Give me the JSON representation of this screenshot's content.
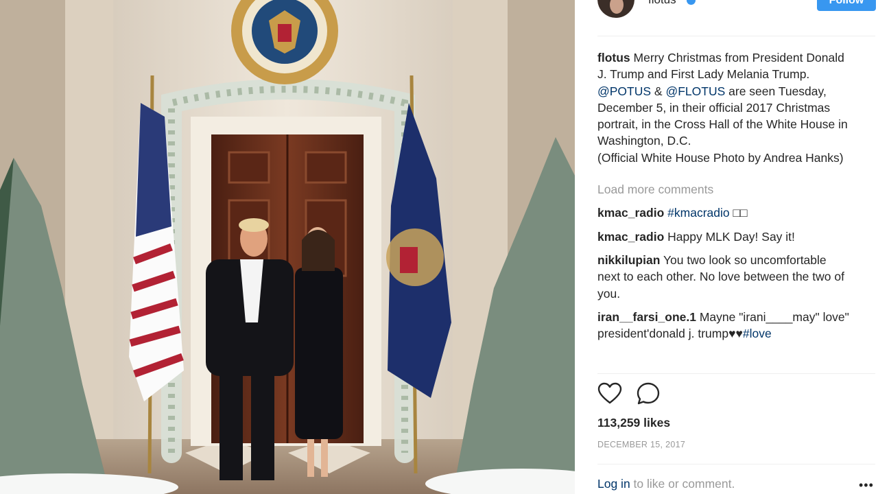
{
  "post": {
    "username": "flotus",
    "follow_label": "Follow",
    "caption": {
      "user": "flotus",
      "line1": " Merry Christmas from President Donald J. Trump and First Lady Melania Trump.",
      "mention1": "@POTUS",
      "amp": " & ",
      "mention2": "@FLOTUS",
      "line2": " are seen Tuesday, December 5, in their official 2017 Christmas portrait, in the Cross Hall of the White House in Washington, D.C.",
      "line3": "(Official White House Photo by Andrea Hanks)"
    },
    "load_more": "Load more comments",
    "comments": [
      {
        "user": "kmac_radio",
        "text": "",
        "tag": "#kmacradio",
        "tail": " □□"
      },
      {
        "user": "kmac_radio",
        "text": " Happy MLK Day! Say it!",
        "tag": "",
        "tail": ""
      },
      {
        "user": "nikkilupian",
        "text": " You two look so uncomfortable next to each other. No love between the two of you.",
        "tag": "",
        "tail": ""
      },
      {
        "user": "iran__farsi_one.1",
        "text": " Mayne \"irani____may\" love\" president'donald j. trump♥♥",
        "tag": "#love",
        "tail": ""
      }
    ],
    "likes": "113,259 likes",
    "date": "DECEMBER 15, 2017",
    "login_link": "Log in",
    "login_tail": " to like or comment.",
    "more_label": "•••"
  },
  "icons": {
    "like": "heart-icon",
    "comment": "comment-bubble-icon",
    "more": "more-options-icon",
    "verified": "verified-badge-icon"
  },
  "colors": {
    "accent": "#3897f0",
    "link": "#003569",
    "muted": "#999999"
  }
}
